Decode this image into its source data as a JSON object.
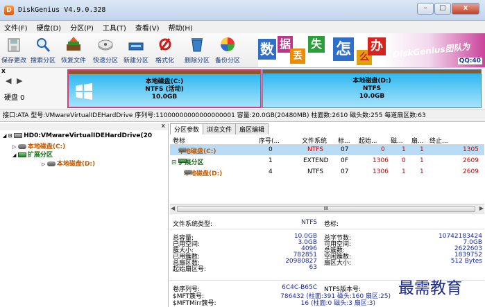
{
  "window": {
    "title": "DiskGenius V4.9.0.328",
    "app_icon": "D",
    "minimize": "–",
    "maximize": "□",
    "close": "x"
  },
  "menu": [
    "文件(F)",
    "硬盘(D)",
    "分区(P)",
    "工具(T)",
    "查看(V)",
    "帮助(H)"
  ],
  "toolbar": [
    {
      "label": "保存更改",
      "icon": "save-disk-icon"
    },
    {
      "label": "搜索分区",
      "icon": "magnifier-icon"
    },
    {
      "label": "恢复文件",
      "icon": "recover-files-icon"
    },
    {
      "label": "快速分区",
      "icon": "quick-partition-icon"
    },
    {
      "label": "新建分区",
      "icon": "new-partition-icon"
    },
    {
      "label": "格式化",
      "icon": "format-icon"
    },
    {
      "label": "删除分区",
      "icon": "trash-icon"
    },
    {
      "label": "备份分区",
      "icon": "backup-icon"
    }
  ],
  "banner": {
    "tiles": [
      "数",
      "据",
      "丢",
      "失",
      "怎",
      "么",
      "办"
    ],
    "brand": "DiskGenius团队为",
    "qq": "QQ:40"
  },
  "disk_map": {
    "nav": "◀ ▶",
    "disk_label": "硬盘 0",
    "close": "x",
    "partition_c": {
      "name": "本地磁盘(C:)",
      "fs": "NTFS (活动)",
      "size": "10.0GB"
    },
    "partition_d": {
      "name": "本地磁盘(D:)",
      "fs": "NTFS",
      "size": "10.0GB"
    }
  },
  "infobar": "接口:ATA  型号:VMwareVirtualIDEHardDrive  序列号:11000000000000000001  容量:20.0GB(20480MB)  柱面数:2610  磁头数:255  每道扇区数:63",
  "tree": {
    "close": "x",
    "disk": "HD0:VMwareVirtualIDEHardDrive(20",
    "c": "本地磁盘(C:)",
    "ext": "扩展分区",
    "d": "本地磁盘(D:)"
  },
  "tabs": [
    "分区参数",
    "浏览文件",
    "扇区编辑"
  ],
  "partition_table": {
    "headers": [
      "卷标",
      "序号(...",
      "文件系统",
      "标...",
      "起始...",
      "磁...",
      "扇...",
      "终止..."
    ],
    "rows": [
      {
        "name": "本地磁盘(C:)",
        "num": "0",
        "fs": "NTFS",
        "id": "07",
        "start": "0",
        "head": "1",
        "sector": "1",
        "end": "1305"
      },
      {
        "name": "扩展分区",
        "num": "1",
        "fs": "EXTEND",
        "id": "0F",
        "start": "1306",
        "head": "0",
        "sector": "1",
        "end": "2609"
      },
      {
        "name": "本地磁盘(D:)",
        "num": "4",
        "fs": "NTFS",
        "id": "07",
        "start": "1306",
        "head": "1",
        "sector": "1",
        "end": "2609"
      }
    ]
  },
  "scroll": {
    "left": "◀",
    "grip": "III",
    "right": "▶"
  },
  "details": {
    "fs_type_label": "文件系统类型:",
    "fs_type": "NTFS",
    "volume_label": "卷标:",
    "left_labels": [
      "总容量:",
      "已用空间:",
      "簇大小:",
      "已用簇数:",
      "总扇区数:",
      "起始扇区号:"
    ],
    "left_values": [
      "10.0GB",
      "3.0GB",
      "4096",
      "782851",
      "20980827",
      "63"
    ],
    "right_labels": [
      "总字节数:",
      "可用空间:",
      "总簇数:",
      "空闲簇数:",
      "扇区大小:"
    ],
    "right_values": [
      "10742183424",
      "7.0GB",
      "2622603",
      "1839752",
      "512 Bytes"
    ],
    "serial_label": "卷序列号:",
    "serial": "6C4C-B65C",
    "ntfs_ver_label": "NTFS版本号:",
    "mft_label": "$MFT簇号:",
    "mft": "786432 (柱面:391 磁头:160 扇区:25)",
    "mftmirr_label": "$MFTMirr簇号:",
    "mftmirr": "16 (柱面:0 磁头:3 扇区:3)"
  },
  "watermark": "最需教育"
}
